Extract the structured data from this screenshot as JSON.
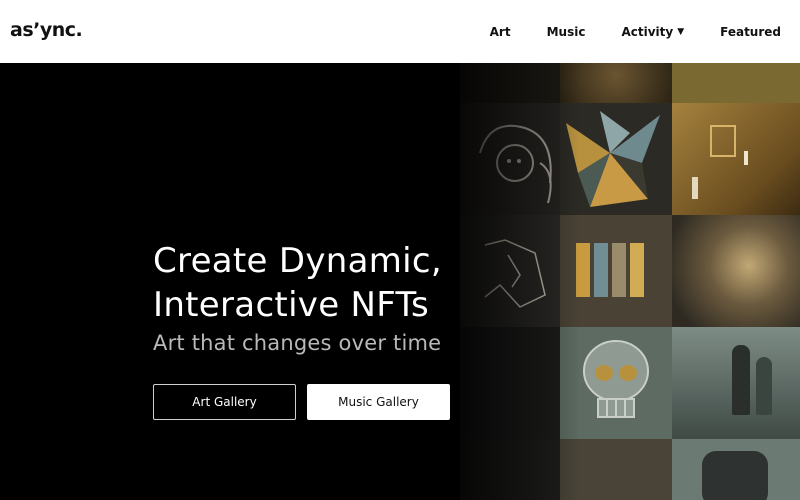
{
  "header": {
    "logo": "as’ync.",
    "nav": [
      {
        "label": "Art"
      },
      {
        "label": "Music"
      },
      {
        "label": "Activity",
        "icon": "caret-down-icon",
        "caret": "▼"
      },
      {
        "label": "Featured"
      }
    ]
  },
  "hero": {
    "headline_line1": "Create Dynamic,",
    "headline_line2": "Interactive NFTs",
    "subheadline": "Art that changes over time",
    "buttons": {
      "art_gallery": "Art Gallery",
      "music_gallery": "Music Gallery"
    }
  },
  "colors": {
    "background": "#000000",
    "header_bg": "#ffffff",
    "accent_gold": "#b8913f",
    "muted_green": "#6f7f6c"
  }
}
